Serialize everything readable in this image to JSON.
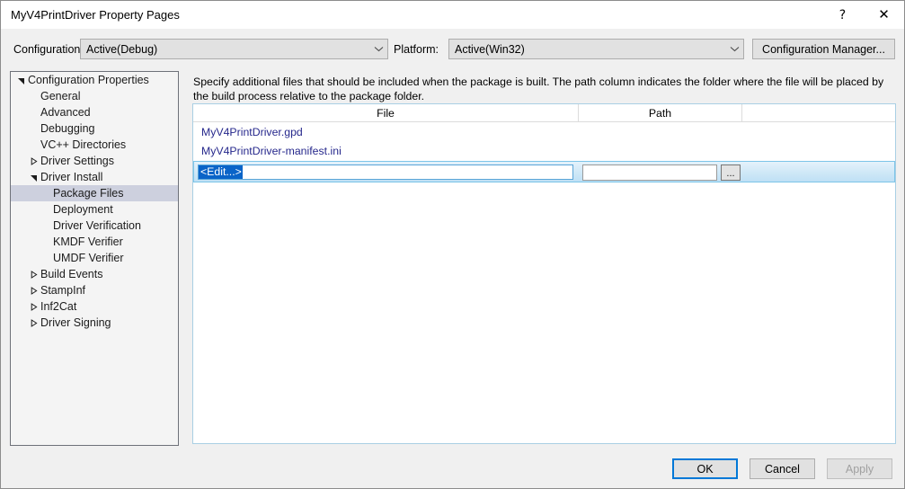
{
  "window": {
    "title": "MyV4PrintDriver Property Pages",
    "help_glyph": "?",
    "close_glyph": "✕"
  },
  "config_bar": {
    "configuration_label": "Configuration:",
    "configuration_value": "Active(Debug)",
    "platform_label": "Platform:",
    "platform_value": "Active(Win32)",
    "configuration_manager_label": "Configuration Manager..."
  },
  "tree": {
    "items": [
      {
        "label": "Configuration Properties",
        "indent": 0,
        "arrow": "expanded",
        "selected": false
      },
      {
        "label": "General",
        "indent": 1,
        "arrow": "none",
        "selected": false
      },
      {
        "label": "Advanced",
        "indent": 1,
        "arrow": "none",
        "selected": false
      },
      {
        "label": "Debugging",
        "indent": 1,
        "arrow": "none",
        "selected": false
      },
      {
        "label": "VC++ Directories",
        "indent": 1,
        "arrow": "none",
        "selected": false
      },
      {
        "label": "Driver Settings",
        "indent": 0,
        "arrow": "collapsed",
        "selected": false,
        "arrow_indent": 1
      },
      {
        "label": "Driver Install",
        "indent": 0,
        "arrow": "expanded",
        "selected": false,
        "arrow_indent": 1
      },
      {
        "label": "Package Files",
        "indent": 2,
        "arrow": "none",
        "selected": true
      },
      {
        "label": "Deployment",
        "indent": 2,
        "arrow": "none",
        "selected": false
      },
      {
        "label": "Driver Verification",
        "indent": 2,
        "arrow": "none",
        "selected": false
      },
      {
        "label": "KMDF Verifier",
        "indent": 2,
        "arrow": "none",
        "selected": false
      },
      {
        "label": "UMDF Verifier",
        "indent": 2,
        "arrow": "none",
        "selected": false
      },
      {
        "label": "Build Events",
        "indent": 0,
        "arrow": "collapsed",
        "selected": false,
        "arrow_indent": 1
      },
      {
        "label": "StampInf",
        "indent": 0,
        "arrow": "collapsed",
        "selected": false,
        "arrow_indent": 1
      },
      {
        "label": "Inf2Cat",
        "indent": 0,
        "arrow": "collapsed",
        "selected": false,
        "arrow_indent": 1
      },
      {
        "label": "Driver Signing",
        "indent": 0,
        "arrow": "collapsed",
        "selected": false,
        "arrow_indent": 1
      }
    ]
  },
  "main": {
    "description": "Specify additional files that should be included when the package is built.  The path column indicates the folder where the file will be placed by the build process relative to the package folder.",
    "columns": {
      "file": "File",
      "path": "Path"
    },
    "rows": [
      {
        "file": "MyV4PrintDriver.gpd",
        "path": ""
      },
      {
        "file": "MyV4PrintDriver-manifest.ini",
        "path": ""
      }
    ],
    "edit_row": {
      "file_value": "<Edit...>",
      "path_value": "",
      "browse_label": "..."
    }
  },
  "footer": {
    "ok_label": "OK",
    "cancel_label": "Cancel",
    "apply_label": "Apply"
  },
  "colors": {
    "accent": "#0078d7",
    "link": "#26288c",
    "selection": "#0a64c8",
    "tree_selection": "#cdd0de"
  }
}
